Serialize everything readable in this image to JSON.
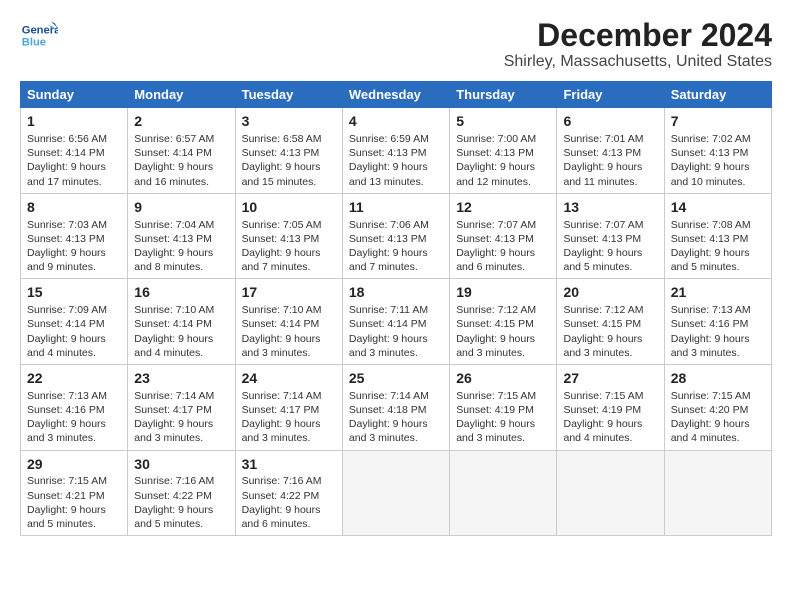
{
  "header": {
    "logo_general": "General",
    "logo_blue": "Blue",
    "title": "December 2024",
    "subtitle": "Shirley, Massachusetts, United States"
  },
  "weekdays": [
    "Sunday",
    "Monday",
    "Tuesday",
    "Wednesday",
    "Thursday",
    "Friday",
    "Saturday"
  ],
  "weeks": [
    [
      {
        "day": 1,
        "sunrise": "6:56 AM",
        "sunset": "4:14 PM",
        "daylight": "9 hours and 17 minutes."
      },
      {
        "day": 2,
        "sunrise": "6:57 AM",
        "sunset": "4:14 PM",
        "daylight": "9 hours and 16 minutes."
      },
      {
        "day": 3,
        "sunrise": "6:58 AM",
        "sunset": "4:13 PM",
        "daylight": "9 hours and 15 minutes."
      },
      {
        "day": 4,
        "sunrise": "6:59 AM",
        "sunset": "4:13 PM",
        "daylight": "9 hours and 13 minutes."
      },
      {
        "day": 5,
        "sunrise": "7:00 AM",
        "sunset": "4:13 PM",
        "daylight": "9 hours and 12 minutes."
      },
      {
        "day": 6,
        "sunrise": "7:01 AM",
        "sunset": "4:13 PM",
        "daylight": "9 hours and 11 minutes."
      },
      {
        "day": 7,
        "sunrise": "7:02 AM",
        "sunset": "4:13 PM",
        "daylight": "9 hours and 10 minutes."
      }
    ],
    [
      {
        "day": 8,
        "sunrise": "7:03 AM",
        "sunset": "4:13 PM",
        "daylight": "9 hours and 9 minutes."
      },
      {
        "day": 9,
        "sunrise": "7:04 AM",
        "sunset": "4:13 PM",
        "daylight": "9 hours and 8 minutes."
      },
      {
        "day": 10,
        "sunrise": "7:05 AM",
        "sunset": "4:13 PM",
        "daylight": "9 hours and 7 minutes."
      },
      {
        "day": 11,
        "sunrise": "7:06 AM",
        "sunset": "4:13 PM",
        "daylight": "9 hours and 7 minutes."
      },
      {
        "day": 12,
        "sunrise": "7:07 AM",
        "sunset": "4:13 PM",
        "daylight": "9 hours and 6 minutes."
      },
      {
        "day": 13,
        "sunrise": "7:07 AM",
        "sunset": "4:13 PM",
        "daylight": "9 hours and 5 minutes."
      },
      {
        "day": 14,
        "sunrise": "7:08 AM",
        "sunset": "4:13 PM",
        "daylight": "9 hours and 5 minutes."
      }
    ],
    [
      {
        "day": 15,
        "sunrise": "7:09 AM",
        "sunset": "4:14 PM",
        "daylight": "9 hours and 4 minutes."
      },
      {
        "day": 16,
        "sunrise": "7:10 AM",
        "sunset": "4:14 PM",
        "daylight": "9 hours and 4 minutes."
      },
      {
        "day": 17,
        "sunrise": "7:10 AM",
        "sunset": "4:14 PM",
        "daylight": "9 hours and 3 minutes."
      },
      {
        "day": 18,
        "sunrise": "7:11 AM",
        "sunset": "4:14 PM",
        "daylight": "9 hours and 3 minutes."
      },
      {
        "day": 19,
        "sunrise": "7:12 AM",
        "sunset": "4:15 PM",
        "daylight": "9 hours and 3 minutes."
      },
      {
        "day": 20,
        "sunrise": "7:12 AM",
        "sunset": "4:15 PM",
        "daylight": "9 hours and 3 minutes."
      },
      {
        "day": 21,
        "sunrise": "7:13 AM",
        "sunset": "4:16 PM",
        "daylight": "9 hours and 3 minutes."
      }
    ],
    [
      {
        "day": 22,
        "sunrise": "7:13 AM",
        "sunset": "4:16 PM",
        "daylight": "9 hours and 3 minutes."
      },
      {
        "day": 23,
        "sunrise": "7:14 AM",
        "sunset": "4:17 PM",
        "daylight": "9 hours and 3 minutes."
      },
      {
        "day": 24,
        "sunrise": "7:14 AM",
        "sunset": "4:17 PM",
        "daylight": "9 hours and 3 minutes."
      },
      {
        "day": 25,
        "sunrise": "7:14 AM",
        "sunset": "4:18 PM",
        "daylight": "9 hours and 3 minutes."
      },
      {
        "day": 26,
        "sunrise": "7:15 AM",
        "sunset": "4:19 PM",
        "daylight": "9 hours and 3 minutes."
      },
      {
        "day": 27,
        "sunrise": "7:15 AM",
        "sunset": "4:19 PM",
        "daylight": "9 hours and 4 minutes."
      },
      {
        "day": 28,
        "sunrise": "7:15 AM",
        "sunset": "4:20 PM",
        "daylight": "9 hours and 4 minutes."
      }
    ],
    [
      {
        "day": 29,
        "sunrise": "7:15 AM",
        "sunset": "4:21 PM",
        "daylight": "9 hours and 5 minutes."
      },
      {
        "day": 30,
        "sunrise": "7:16 AM",
        "sunset": "4:22 PM",
        "daylight": "9 hours and 5 minutes."
      },
      {
        "day": 31,
        "sunrise": "7:16 AM",
        "sunset": "4:22 PM",
        "daylight": "9 hours and 6 minutes."
      },
      null,
      null,
      null,
      null
    ]
  ]
}
